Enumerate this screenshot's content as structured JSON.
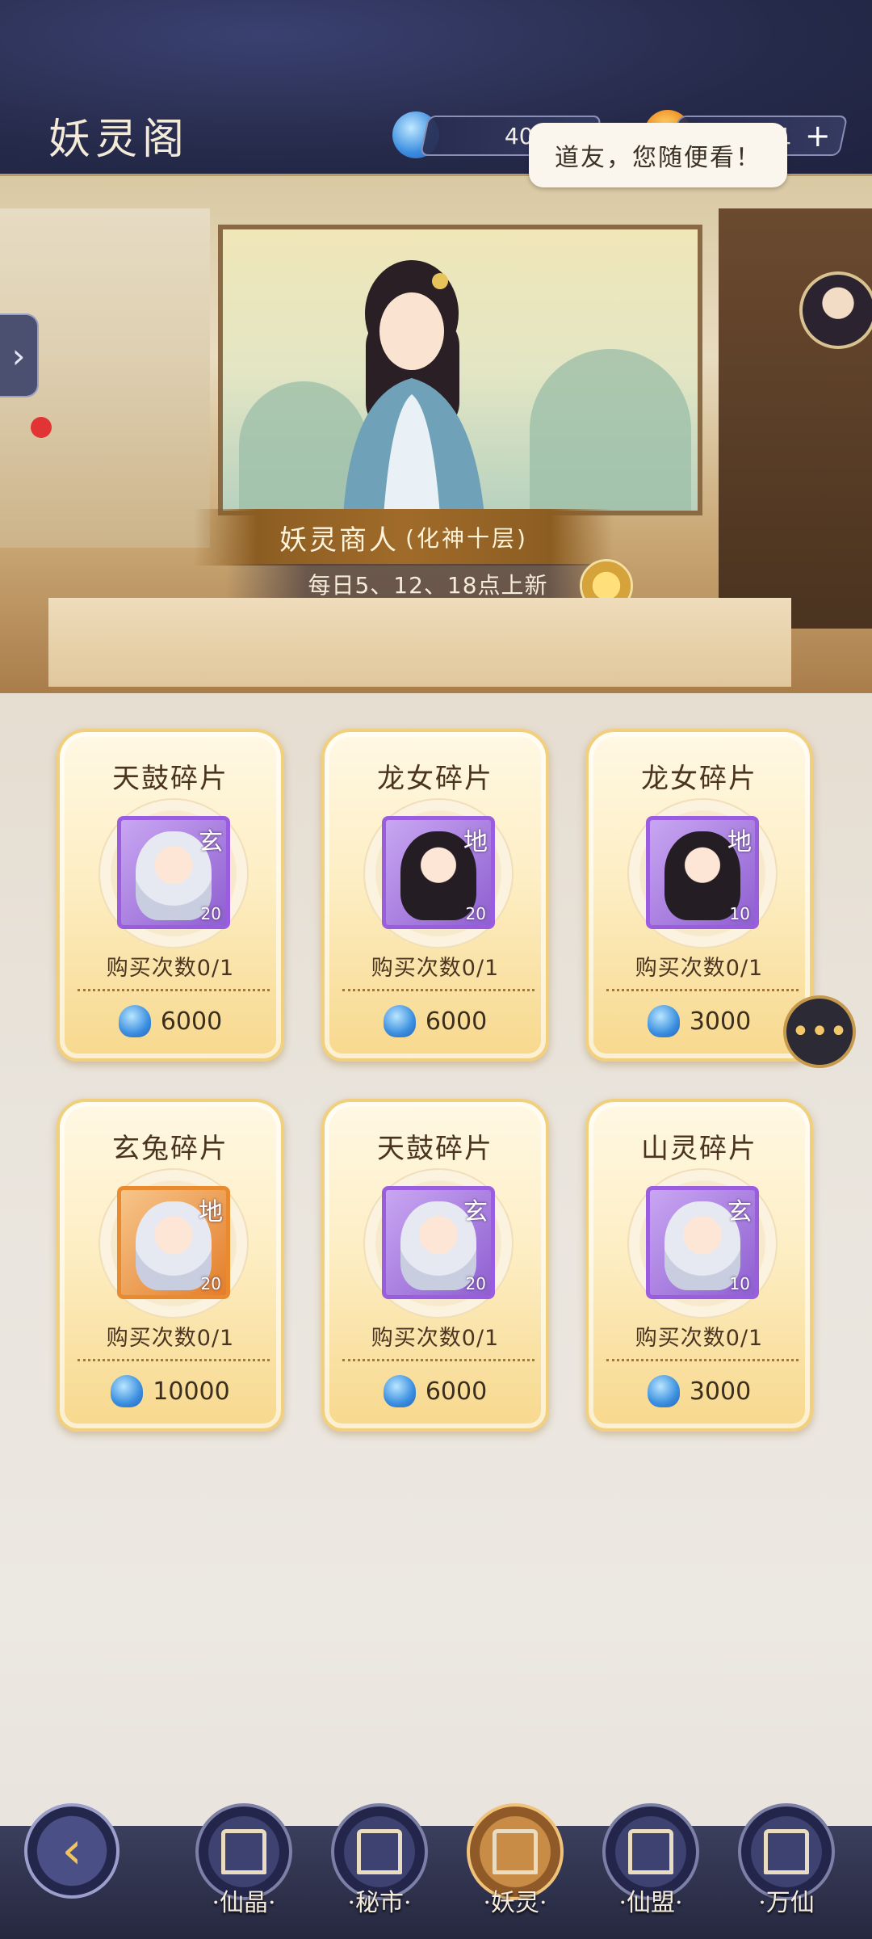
{
  "header": {
    "title": "妖灵阁",
    "currency_spirit": "40725",
    "currency_flame": "11131",
    "plus_label": "+"
  },
  "scene": {
    "speech": "道友，您随便看！",
    "merchant_name": "妖灵商人",
    "merchant_rank": "(化神十层)",
    "refresh_schedule": "每日5、12、18点上新"
  },
  "items": [
    {
      "name": "天鼓碎片",
      "grade": "玄",
      "count": "20",
      "limit": "购买次数0/1",
      "price": "6000",
      "frame": "purple",
      "hair": "light"
    },
    {
      "name": "龙女碎片",
      "grade": "地",
      "count": "20",
      "limit": "购买次数0/1",
      "price": "6000",
      "frame": "purple",
      "hair": "dark"
    },
    {
      "name": "龙女碎片",
      "grade": "地",
      "count": "10",
      "limit": "购买次数0/1",
      "price": "3000",
      "frame": "purple",
      "hair": "dark"
    },
    {
      "name": "玄兔碎片",
      "grade": "地",
      "count": "20",
      "limit": "购买次数0/1",
      "price": "10000",
      "frame": "orange",
      "hair": "light"
    },
    {
      "name": "天鼓碎片",
      "grade": "玄",
      "count": "20",
      "limit": "购买次数0/1",
      "price": "6000",
      "frame": "purple",
      "hair": "light"
    },
    {
      "name": "山灵碎片",
      "grade": "玄",
      "count": "10",
      "limit": "购买次数0/1",
      "price": "3000",
      "frame": "purple",
      "hair": "light"
    }
  ],
  "nav": {
    "items": [
      {
        "label": "·仙晶·"
      },
      {
        "label": "·秘市·"
      },
      {
        "label": "·妖灵·"
      },
      {
        "label": "·仙盟·"
      },
      {
        "label": "·万仙"
      }
    ]
  },
  "colors": {
    "header_bg": "#262a4a",
    "accent_gold": "#f1cf7c",
    "frame_purple": "#9b5de0",
    "frame_orange": "#e98a2e"
  }
}
